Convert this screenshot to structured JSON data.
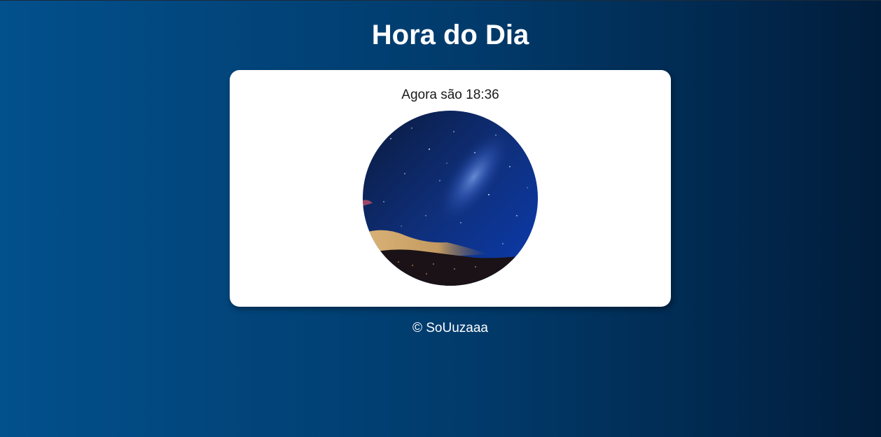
{
  "page": {
    "title": "Hora do Dia",
    "time_message": "Agora são 18:36",
    "image_icon": "night-sky-image",
    "footer": "© SoUuzaaa"
  },
  "colors": {
    "background_left": "#02508c",
    "background_right": "#011d3c",
    "card": "#ffffff",
    "title_text": "#ffffff"
  }
}
